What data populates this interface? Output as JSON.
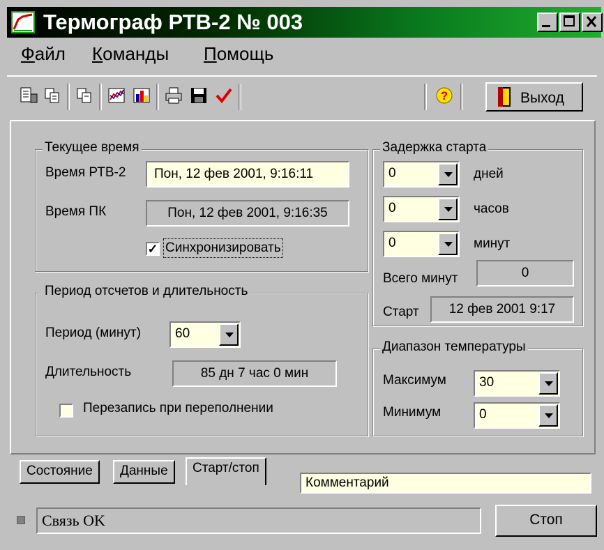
{
  "window": {
    "title": "Термограф РТВ-2 № 003"
  },
  "menu": {
    "file": "Файл",
    "commands": "Команды",
    "help": "Помощь"
  },
  "toolbar": {
    "exit_label": "Выход"
  },
  "current_time": {
    "title": "Текущее время",
    "rtv_label": "Время РТВ-2",
    "rtv_value": "Пон, 12 фев 2001,  9:16:11",
    "pc_label": "Время ПК",
    "pc_value": "Пон, 12 фев 2001, 9:16:35",
    "sync_label": "Синхронизировать",
    "sync_checked": true
  },
  "period": {
    "title": "Период отсчетов и длительность",
    "period_label": "Период (минут)",
    "period_value": "60",
    "duration_label": "Длительность",
    "duration_value": "85 дн 7 час  0 мин",
    "overwrite_label": "Перезапись при переполнении",
    "overwrite_checked": false
  },
  "delay": {
    "title": "Задержка старта",
    "days_value": "0",
    "days_label": "дней",
    "hours_value": "0",
    "hours_label": "часов",
    "minutes_value": "0",
    "minutes_label": "минут",
    "total_label": "Всего минут",
    "total_value": "0",
    "start_label": "Старт",
    "start_value": "12 фев 2001 9:17"
  },
  "temp_range": {
    "title": "Диапазон температуры",
    "max_label": "Максимум",
    "max_value": "30",
    "min_label": "Минимум",
    "min_value": "0"
  },
  "tabs": {
    "state": "Состояние",
    "data": "Данные",
    "startstop": "Старт/стоп"
  },
  "comment": "Комментарий",
  "status": {
    "text": "Связь OK",
    "stop_label": "Стоп"
  },
  "colors": {
    "face": "#c0c0c0",
    "input_yellow": "#ffffe1",
    "title_green": "#1fae2e"
  }
}
